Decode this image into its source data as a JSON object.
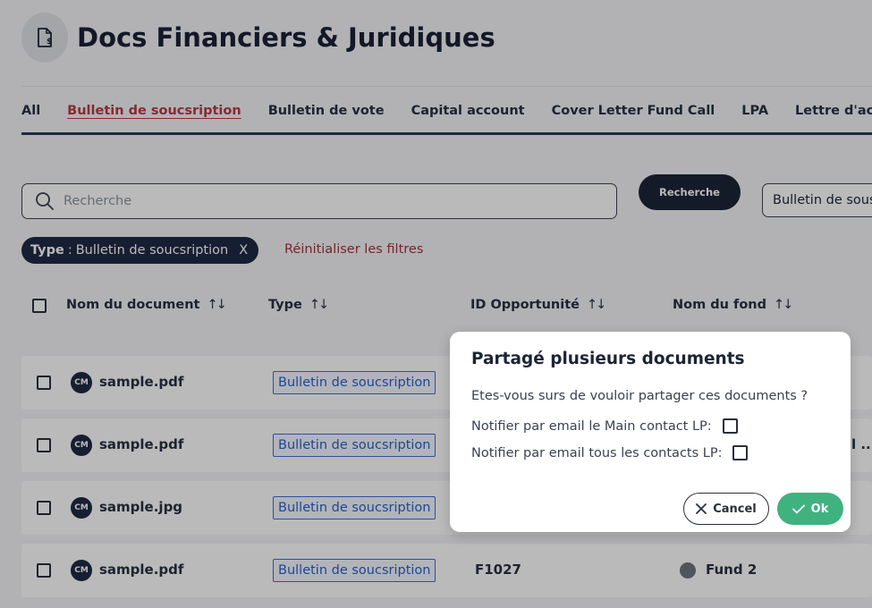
{
  "header": {
    "title": "Docs Financiers & Juridiques",
    "icon": "document-dollar-icon"
  },
  "tabs": [
    {
      "label": "All",
      "active": false
    },
    {
      "label": "Bulletin de soucsription",
      "active": true
    },
    {
      "label": "Bulletin de vote",
      "active": false
    },
    {
      "label": "Capital account",
      "active": false
    },
    {
      "label": "Cover Letter Fund Call",
      "active": false
    },
    {
      "label": "LPA",
      "active": false
    },
    {
      "label": "Lettre d'acco",
      "active": false
    }
  ],
  "search": {
    "placeholder": "Recherche",
    "button_label": "Recherche"
  },
  "type_select": {
    "value": "Bulletin de sous"
  },
  "filter": {
    "key": "Type",
    "separator": ":",
    "value": "Bulletin de soucsription",
    "remove": "X"
  },
  "reset_label": "Réinitialiser les filtres",
  "table": {
    "columns": [
      {
        "label": "Nom du document",
        "sort": "↑↓"
      },
      {
        "label": "Type",
        "sort": "↑↓"
      },
      {
        "label": "ID Opportunité",
        "sort": "↑↓"
      },
      {
        "label": "Nom du fond",
        "sort": "↑↓"
      }
    ],
    "rows": [
      {
        "avatar": "CM",
        "name": "sample.pdf",
        "type": "Bulletin de soucsription",
        "id": "",
        "fund": ""
      },
      {
        "avatar": "CM",
        "name": "sample.pdf",
        "type": "Bulletin de soucsription",
        "id": "",
        "fund": "",
        "extra": "l ..."
      },
      {
        "avatar": "CM",
        "name": "sample.jpg",
        "type": "Bulletin de soucsription",
        "id": "",
        "fund": ""
      },
      {
        "avatar": "CM",
        "name": "sample.pdf",
        "type": "Bulletin de soucsription",
        "id": "F1027",
        "fund": "Fund 2"
      }
    ]
  },
  "modal": {
    "title": "Partagé plusieurs documents",
    "question": "Etes-vous surs de vouloir partager ces documents ?",
    "notify_main": "Notifier par email le Main contact LP:",
    "notify_all": "Notifier par email tous les contacts LP:",
    "cancel_label": "Cancel",
    "ok_label": "Ok"
  },
  "colors": {
    "navy": "#1c2438",
    "accent_red": "#b93a3f",
    "ok_green": "#3fb27f",
    "badge_blue": "#2c5fc8"
  }
}
